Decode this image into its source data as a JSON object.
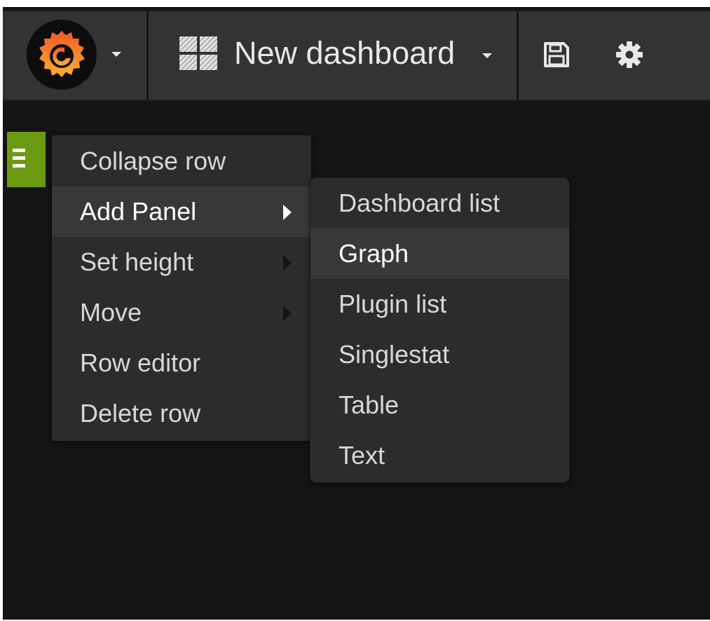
{
  "navbar": {
    "dashboard_title": "New dashboard",
    "icons": {
      "logo": "grafana-logo-icon",
      "logo_caret": "caret-down-icon",
      "dashboard": "dashboard-grid-icon",
      "title_caret": "caret-down-icon",
      "save": "save-floppy-icon",
      "settings": "gear-icon"
    }
  },
  "row": {
    "handle_icon": "hamburger-icon",
    "handle_color": "#6c9a12"
  },
  "row_menu": {
    "items": [
      {
        "label": "Collapse row",
        "has_submenu": false,
        "active": false
      },
      {
        "label": "Add Panel",
        "has_submenu": true,
        "active": true
      },
      {
        "label": "Set height",
        "has_submenu": true,
        "active": false
      },
      {
        "label": "Move",
        "has_submenu": true,
        "active": false
      },
      {
        "label": "Row editor",
        "has_submenu": false,
        "active": false
      },
      {
        "label": "Delete row",
        "has_submenu": false,
        "active": false
      }
    ]
  },
  "add_panel_submenu": {
    "items": [
      {
        "label": "Dashboard list",
        "active": false
      },
      {
        "label": "Graph",
        "active": true
      },
      {
        "label": "Plugin list",
        "active": false
      },
      {
        "label": "Singlestat",
        "active": false
      },
      {
        "label": "Table",
        "active": false
      },
      {
        "label": "Text",
        "active": false
      }
    ]
  },
  "colors": {
    "background": "#141414",
    "navbar": "#333333",
    "menu": "#2c2c2c",
    "menu_active": "#383838",
    "accent_green": "#6c9a12",
    "logo_orange": "#f47a20",
    "logo_yellow": "#fbb033"
  }
}
